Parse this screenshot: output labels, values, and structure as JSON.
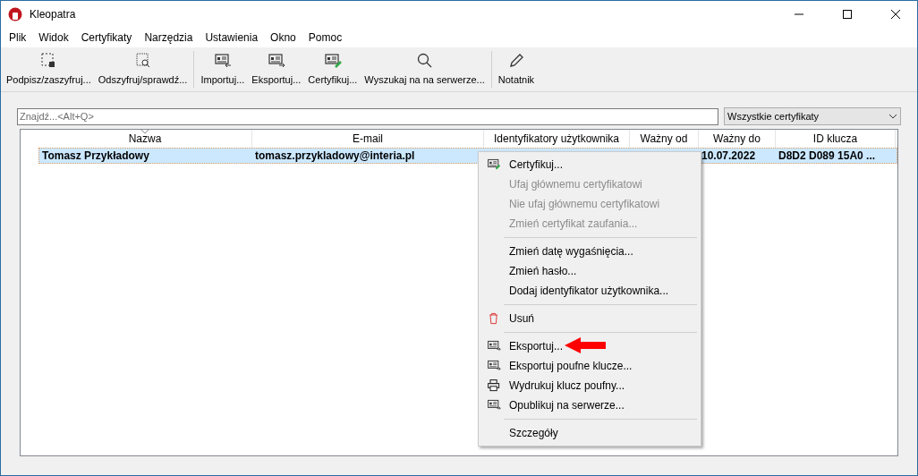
{
  "window": {
    "title": "Kleopatra"
  },
  "menu_bar": [
    "Plik",
    "Widok",
    "Certyfikaty",
    "Narzędzia",
    "Ustawienia",
    "Okno",
    "Pomoc"
  ],
  "toolbar": [
    {
      "label": "Podpisz/zaszyfruj..."
    },
    {
      "label": "Odszyfruj/sprawdź..."
    },
    {
      "label": "Importuj..."
    },
    {
      "label": "Eksportuj..."
    },
    {
      "label": "Certyfikuj..."
    },
    {
      "label": "Wyszukaj na na serwerze..."
    },
    {
      "label": "Notatnik"
    }
  ],
  "search": {
    "placeholder": "Znajdź...<Alt+Q>"
  },
  "filter": {
    "value": "Wszystkie certyfikaty"
  },
  "table": {
    "columns": [
      "Nazwa",
      "E-mail",
      "Identyfikatory użytkownika",
      "Ważny od",
      "Ważny do",
      "ID klucza"
    ],
    "rows": [
      {
        "selected": true,
        "cells": [
          "Tomasz Przykładowy",
          "tomasz.przykladowy@interia.pl",
          "",
          "",
          "10.07.2022",
          "D8D2 D089 15A0 ..."
        ]
      }
    ]
  },
  "context_menu": [
    {
      "kind": "item",
      "label": "Certyfikuj...",
      "disabled": false
    },
    {
      "kind": "item",
      "label": "Ufaj głównemu certyfikatowi",
      "disabled": true
    },
    {
      "kind": "item",
      "label": "Nie ufaj głównemu certyfikatowi",
      "disabled": true
    },
    {
      "kind": "item",
      "label": "Zmień certyfikat zaufania...",
      "disabled": true
    },
    {
      "kind": "separator"
    },
    {
      "kind": "item",
      "label": "Zmień datę wygaśnięcia...",
      "disabled": false
    },
    {
      "kind": "item",
      "label": "Zmień hasło...",
      "disabled": false
    },
    {
      "kind": "item",
      "label": "Dodaj identyfikator użytkownika...",
      "disabled": false
    },
    {
      "kind": "separator"
    },
    {
      "kind": "item",
      "label": "Usuń",
      "disabled": false
    },
    {
      "kind": "separator"
    },
    {
      "kind": "item",
      "label": "Eksportuj...",
      "disabled": false
    },
    {
      "kind": "item",
      "label": "Eksportuj poufne klucze...",
      "disabled": false
    },
    {
      "kind": "item",
      "label": "Wydrukuj klucz poufny...",
      "disabled": false
    },
    {
      "kind": "item",
      "label": "Opublikuj na serwerze...",
      "disabled": false
    },
    {
      "kind": "separator"
    },
    {
      "kind": "item",
      "label": "Szczegóły",
      "disabled": false
    }
  ]
}
